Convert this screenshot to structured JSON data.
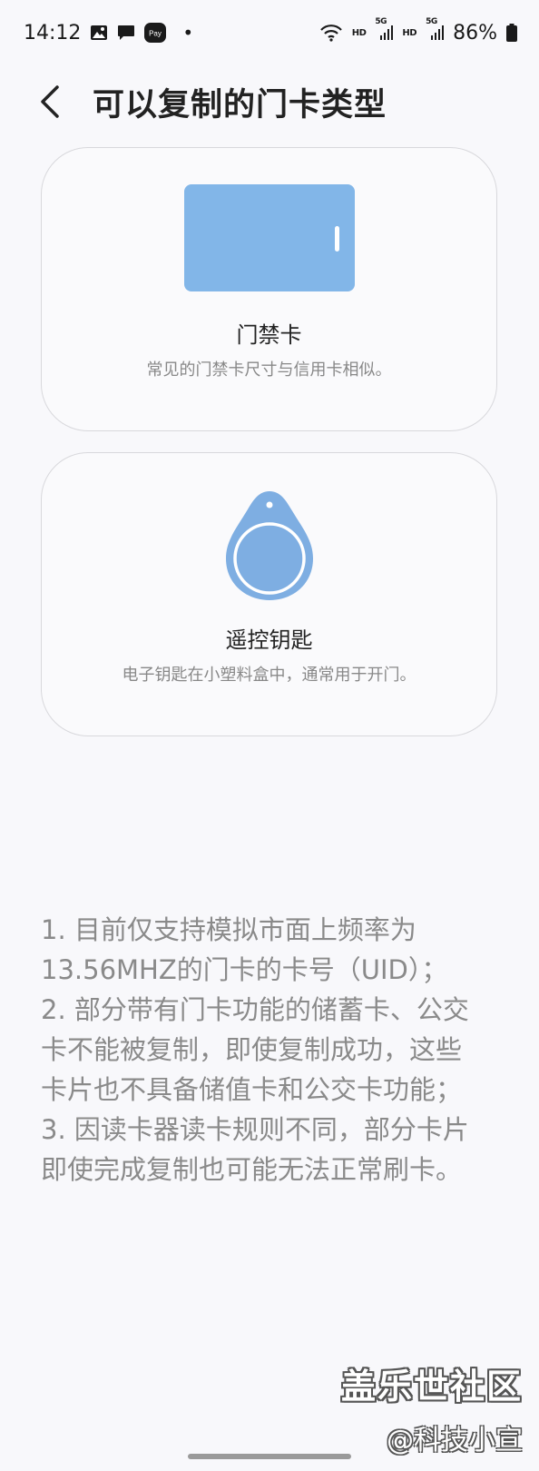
{
  "status_bar": {
    "time": "14:12",
    "pay_label": "Pay",
    "dot": "•",
    "hd_1": "HD",
    "net_1": "5G",
    "hd_2": "HD",
    "net_2": "5G",
    "battery": "86%",
    "icons": [
      "image-icon",
      "message-icon",
      "pay-icon",
      "wifi-icon",
      "signal-icon",
      "signal-icon",
      "battery-icon"
    ]
  },
  "header": {
    "title": "可以复制的门卡类型"
  },
  "cards": [
    {
      "title": "门禁卡",
      "desc": "常见的门禁卡尺寸与信用卡相似。",
      "icon": "access-card-icon"
    },
    {
      "title": "遥控钥匙",
      "desc": "电子钥匙在小塑料盒中，通常用于开门。",
      "icon": "key-fob-icon"
    }
  ],
  "notes": [
    "1. 目前仅支持模拟市面上频率为",
    "13.56MHZ的门卡的卡号（UID）；",
    "2. 部分带有门卡功能的储蓄卡、公交",
    "卡不能被复制，即使复制成功，这些",
    "卡片也不具备储值卡和公交卡功能；",
    "3. 因读卡器读卡规则不同，部分卡片",
    "即使完成复制也可能无法正常刷卡。"
  ],
  "watermark": {
    "line1": "盖乐世社区",
    "line2": "@科技小宣"
  },
  "colors": {
    "background": "#f8f8fb",
    "card_art": "#82b6e8",
    "fob_body": "#7eaee2"
  }
}
